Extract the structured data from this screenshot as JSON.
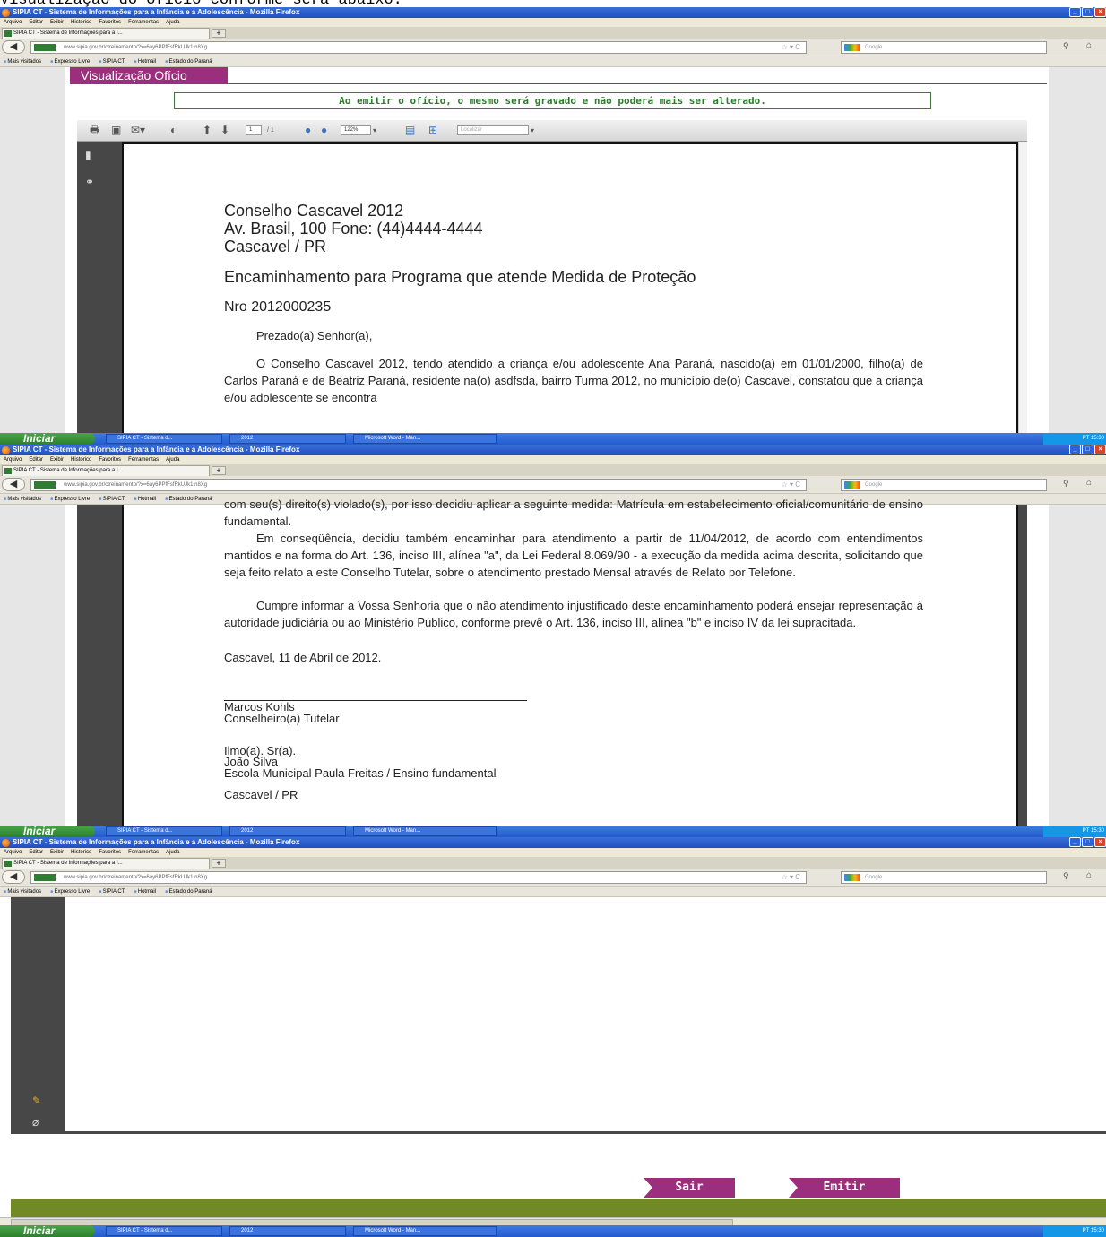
{
  "caption": "Visualização do ofício conforme será abaixo:",
  "browser": {
    "title": "SIPIA CT - Sistema de Informações para a Infância e a Adolescência - Mozilla Firefox",
    "menu": [
      "Arquivo",
      "Editar",
      "Exibir",
      "Histórico",
      "Favoritos",
      "Ferramentas",
      "Ajuda"
    ],
    "tab_label": "SIPIA CT - Sistema de Informações para a I...",
    "url": "www.sipia.gov.br/ctreinamento/?x=6ay6PPfFsfRkUJk1In8Xg",
    "search_placeholder": "Google",
    "bookmarks": [
      "Mais visitados",
      "Expresso Livre",
      "SIPIA CT",
      "Hotmail",
      "Estado do Paraná"
    ]
  },
  "taskbar": {
    "start": "Iniciar",
    "tasks": [
      "SIPIA CT - Sistema d...",
      "2012",
      "Microsoft Word - Man..."
    ],
    "tray_lang": "PT",
    "clock": "15:30"
  },
  "page": {
    "header": "Visualização Ofício",
    "notice": "Ao emitir o ofício, o mesmo será gravado e não poderá mais ser alterado."
  },
  "pdf_toolbar": {
    "page_input": "1",
    "page_total": "/ 1",
    "zoom": "122%",
    "find_placeholder": "Localizar"
  },
  "letter": {
    "org_name": "Conselho Cascavel 2012",
    "org_address": "Av. Brasil, 100  Fone: (44)4444-4444",
    "org_city": "Cascavel / PR",
    "subject": "Encaminhamento para Programa que atende Medida de Proteção",
    "number": "Nro 2012000235",
    "greeting": "Prezado(a) Senhor(a),",
    "para1": "O Conselho Cascavel 2012, tendo atendido a criança e/ou adolescente Ana Paraná, nascido(a) em 01/01/2000, filho(a) de Carlos Paraná e de Beatriz Paraná, residente na(o) asdfsda, bairro Turma 2012, no município de(o) Cascavel, constatou que a criança e/ou adolescente se encontra",
    "para1_cont": "com seu(s) direito(s) violado(s), por isso decidiu aplicar a seguinte medida: Matrícula em estabelecimento oficial/comunitário de ensino fundamental.",
    "para2": "Em conseqüência, decidiu também encaminhar para atendimento a partir de 11/04/2012, de acordo com entendimentos mantidos e na forma do Art. 136, inciso III, alínea \"a\", da Lei Federal 8.069/90 - a execução da medida acima descrita, solicitando que seja feito relato a este Conselho Tutelar, sobre o atendimento prestado Mensal através de Relato por Telefone.",
    "para3": "Cumpre informar a Vossa Senhoria que o não atendimento injustificado deste encaminhamento poderá ensejar representação à autoridade judiciária ou ao Ministério Público, conforme prevê o Art. 136, inciso III, alínea \"b\" e inciso IV da lei supracitada.",
    "date_line": "Cascavel, 11 de Abril de 2012.",
    "signer": "Marcos Kohls",
    "signer_role": "Conselheiro(a) Tutelar",
    "addressee_title": "Ilmo(a).  Sr(a).",
    "addressee_name": "João Silva",
    "addressee_org": "Escola Municipal Paula Freitas / Ensino fundamental",
    "addressee_city": "Cascavel / PR"
  },
  "actions": {
    "exit": "Sair",
    "emit": "Emitir"
  },
  "colors": {
    "brand": "#9b2f7e",
    "notice_green": "#2c7a2c",
    "footer_green": "#718a26"
  }
}
